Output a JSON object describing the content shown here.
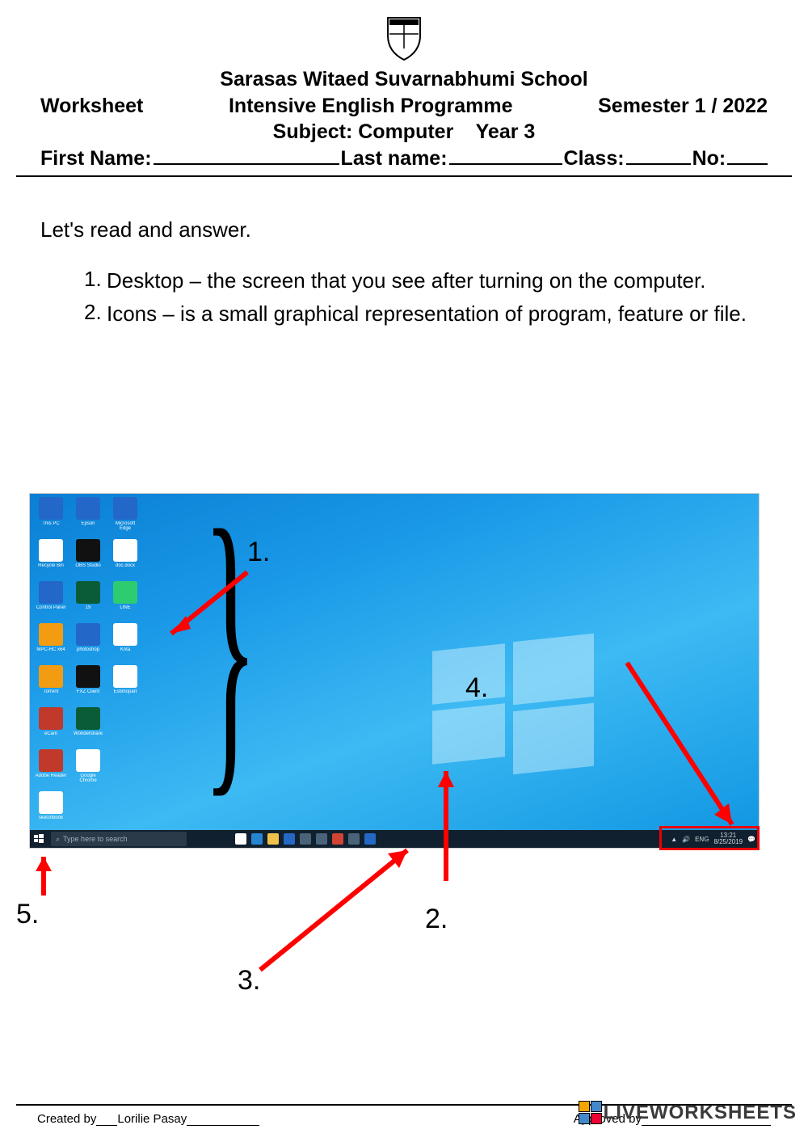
{
  "header": {
    "school": "Sarasas Witaed Suvarnabhumi School",
    "worksheet_label": "Worksheet",
    "programme": "Intensive English Programme",
    "semester": "Semester 1 / 2022",
    "subject_line": "Subject: Computer    Year 3",
    "first_name_label": "First Name:",
    "last_name_label": "Last name:",
    "class_label": "Class:",
    "no_label": "No:"
  },
  "instruction": "Let's read and answer.",
  "definitions": [
    {
      "num": "1.",
      "text": "Desktop – the screen that you see after turning on the computer."
    },
    {
      "num": "2.",
      "text": "Icons – is a small graphical representation of program, feature or file."
    }
  ],
  "figure": {
    "labels": {
      "l1": "1.",
      "l2": "2.",
      "l3": "3.",
      "l4": "4.",
      "l5": "5."
    },
    "search_placeholder": "Type here to search",
    "systray": {
      "lang": "ENG",
      "time": "13:21",
      "date": "8/25/2019"
    },
    "desktop_icons": [
      {
        "label": "This PC",
        "cls": "ic-blue"
      },
      {
        "label": "Epson",
        "cls": "ic-blue"
      },
      {
        "label": "Microsoft Edge",
        "cls": "ic-blue"
      },
      {
        "label": "Recycle Bin",
        "cls": ""
      },
      {
        "label": "OBS Studio",
        "cls": "ic-rdk"
      },
      {
        "label": "doc.docx",
        "cls": ""
      },
      {
        "label": "Control Panel",
        "cls": "ic-blue"
      },
      {
        "label": "19",
        "cls": "ic-dg"
      },
      {
        "label": "LINE",
        "cls": "ic-gr"
      },
      {
        "label": "MPC-HC x64",
        "cls": "ic-or"
      },
      {
        "label": "photoshop",
        "cls": "ic-blue"
      },
      {
        "label": "Krita",
        "cls": ""
      },
      {
        "label": "Torrent",
        "cls": "ic-or"
      },
      {
        "label": "FXZ Client",
        "cls": "ic-rdk"
      },
      {
        "label": "Estimopart",
        "cls": ""
      },
      {
        "label": "eCam",
        "cls": "ic-red"
      },
      {
        "label": "Wondershare",
        "cls": "ic-dg"
      },
      {
        "label": "",
        "cls": "hide"
      },
      {
        "label": "Adobe Reader",
        "cls": "ic-red"
      },
      {
        "label": "Google Chrome",
        "cls": ""
      },
      {
        "label": "",
        "cls": "hide"
      },
      {
        "label": "sketchbook",
        "cls": ""
      }
    ]
  },
  "footer": {
    "created_label": "Created by",
    "created_name": "Lorilie Pasay",
    "approved_label": "Approved by"
  },
  "watermark": "LIVEWORKSHEETS"
}
